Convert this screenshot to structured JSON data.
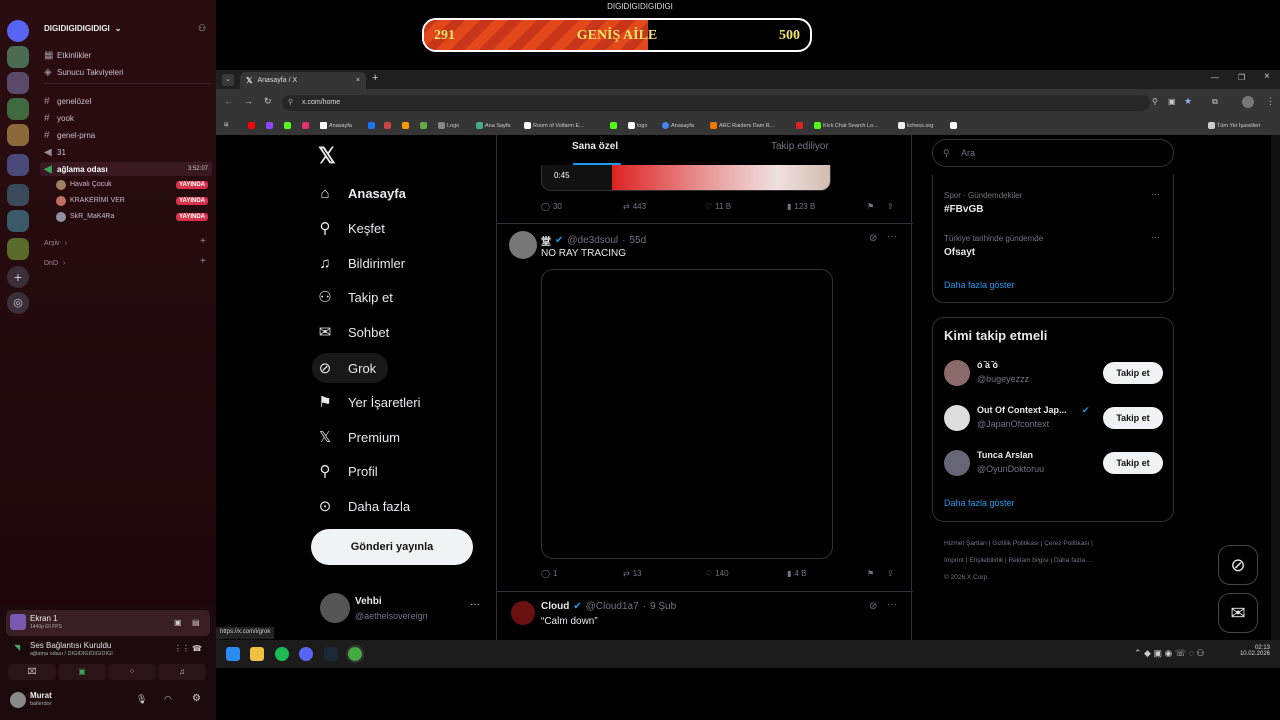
{
  "window_title": "DIGIDIGIDIGIDIGI",
  "banner": {
    "left": "291",
    "center": "GENİŞ AİLE",
    "right": "500",
    "progress": 0.58
  },
  "discord": {
    "server_name": "DIGIDIGIDIGIDIGI",
    "top_items": [
      "Etkinlikler",
      "Sunucu Takviyeleri"
    ],
    "channels": [
      "genelözel",
      "yook",
      "genel-prna",
      "31"
    ],
    "voice_channel": {
      "name": "ağlama odası",
      "timer": "3:52:07"
    },
    "voice_users": [
      {
        "name": "Havalı Çocuk",
        "badge": "YAYINDA"
      },
      {
        "name": "KRAKERİMİ VER",
        "badge": "YAYINDA"
      },
      {
        "name": "SkR_MaK4Ra",
        "badge": "YAYINDA"
      }
    ],
    "categories": [
      "Arşiv",
      "DnD"
    ],
    "stream": {
      "title": "Ekran 1",
      "subtitle": "1440p 60 FPS"
    },
    "voice_status": {
      "title": "Ses Bağlantısı Kuruldu",
      "subtitle": "ağlama odası / DIGIDIGIDIGIDIGI"
    },
    "user": {
      "name": "Murat",
      "status": "ballerdor"
    }
  },
  "browser": {
    "tab_title": "Anasayfa / X",
    "url": "x.com/home",
    "bookmarks": [
      "Anasayfa",
      "Logo",
      "Ana Sayfa",
      "Room of Voltarm E...",
      "logo",
      "Anasayfa",
      "ARC Raiders Dam R...",
      "Kick Chat Search Lo...",
      "lichess.org"
    ],
    "all_bookmarks": "Tüm Yer İşaretleri",
    "status_url": "https://x.com/i/grok"
  },
  "x": {
    "nav": [
      {
        "label": "Anasayfa",
        "icon": "home-icon"
      },
      {
        "label": "Keşfet",
        "icon": "search-icon"
      },
      {
        "label": "Bildirimler",
        "icon": "bell-icon"
      },
      {
        "label": "Takip et",
        "icon": "person-add-icon"
      },
      {
        "label": "Sohbet",
        "icon": "mail-icon"
      },
      {
        "label": "Grok",
        "icon": "grok-icon"
      },
      {
        "label": "Yer İşaretleri",
        "icon": "bookmark-icon"
      },
      {
        "label": "Premium",
        "icon": "x-logo-icon"
      },
      {
        "label": "Profil",
        "icon": "user-icon"
      },
      {
        "label": "Daha fazla",
        "icon": "more-circle-icon"
      }
    ],
    "post_button": "Gönderi yayınla",
    "account": {
      "name": "Vehbi",
      "handle": "@aethelsovereign"
    },
    "tabs": {
      "for_you": "Sana özel",
      "following": "Takip ediliyor"
    },
    "post1": {
      "video_time": "0:45",
      "replies": "30",
      "reposts": "443",
      "likes": "11 B",
      "views": "123 B"
    },
    "post2": {
      "name": "堂",
      "handle": "@de3dsoul",
      "time": "55d",
      "text": "NO RAY TRACING",
      "replies": "1",
      "reposts": "13",
      "likes": "140",
      "views": "4 B"
    },
    "post3": {
      "name": "Cloud",
      "handle": "@Cloud1a7",
      "time": "9 Şub",
      "text": "“Calm down”"
    },
    "search_placeholder": "Ara",
    "trends": [
      {
        "context": "Spor · Gündemdekiler",
        "name": "#FBvGB"
      },
      {
        "context": "Türkiye tarihinde gündemde",
        "name": "Ofsayt"
      }
    ],
    "show_more": "Daha fazla göster",
    "who_to_follow": {
      "title": "Kimi takip etmeli",
      "users": [
        {
          "name": "ó ̄ä ̄ó",
          "handle": "@bugeyezzz"
        },
        {
          "name": "Out Of Context Jap...",
          "handle": "@JapanOfcontext"
        },
        {
          "name": "Tunca Arslan",
          "handle": "@OyunDoktoruu"
        }
      ],
      "follow_label": "Takip et"
    },
    "footer": [
      "Hizmet Şartları",
      "Gizlilik Politikası",
      "Çerez Politikası",
      "Imprint",
      "Erişilebilirlik",
      "Reklam bilgisi",
      "Daha fazla ...",
      "© 2026 X Corp."
    ]
  },
  "taskbar": {
    "time": "02:13",
    "date": "10.02.2026"
  }
}
